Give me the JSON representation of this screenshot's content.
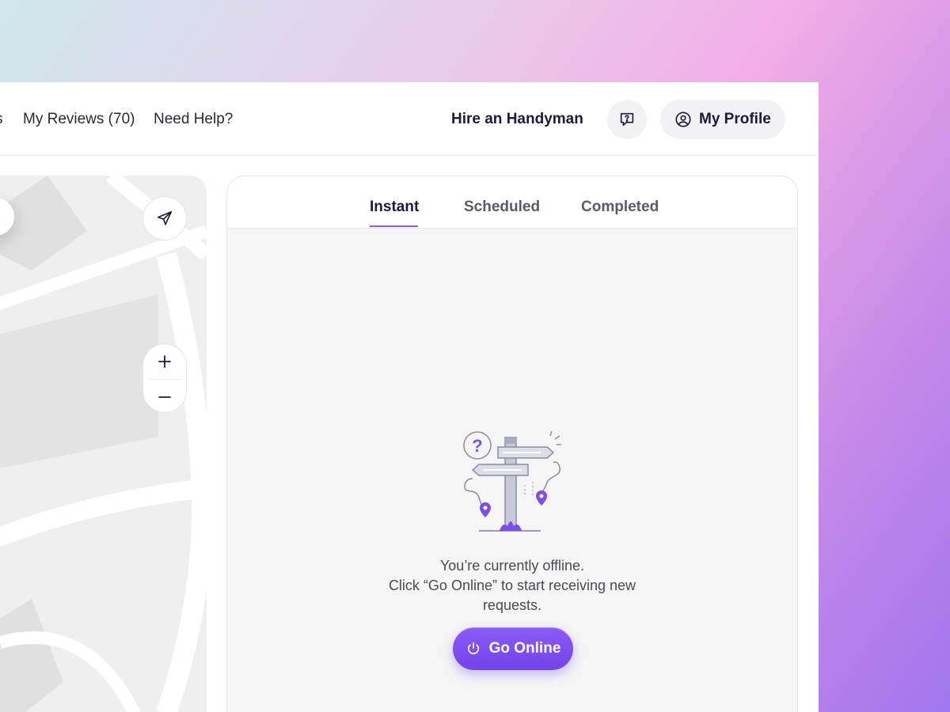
{
  "nav": {
    "partial_link": "s",
    "reviews_label": "My Reviews (70)",
    "help_label": "Need Help?",
    "hire_label": "Hire an Handyman",
    "profile_label": "My Profile"
  },
  "icons": {
    "support": "chat-question-icon",
    "profile": "user-circle-icon",
    "locate": "navigation-arrow-icon",
    "zoom_in": "plus-icon",
    "zoom_out": "minus-icon",
    "power": "power-icon"
  },
  "map_controls": {
    "zoom_in_label": "+",
    "zoom_out_label": "−"
  },
  "tabs": [
    {
      "label": "Instant",
      "active": true
    },
    {
      "label": "Scheduled",
      "active": false
    },
    {
      "label": "Completed",
      "active": false
    }
  ],
  "empty_state": {
    "line1": "You’re currently offline.",
    "line2": "Click “Go Online” to start receiving new",
    "line3": "requests.",
    "button_label": "Go Online"
  },
  "colors": {
    "accent": "#7c4dee",
    "text_dark": "#1d1a3a",
    "panel_bg": "#f5f5f6"
  }
}
